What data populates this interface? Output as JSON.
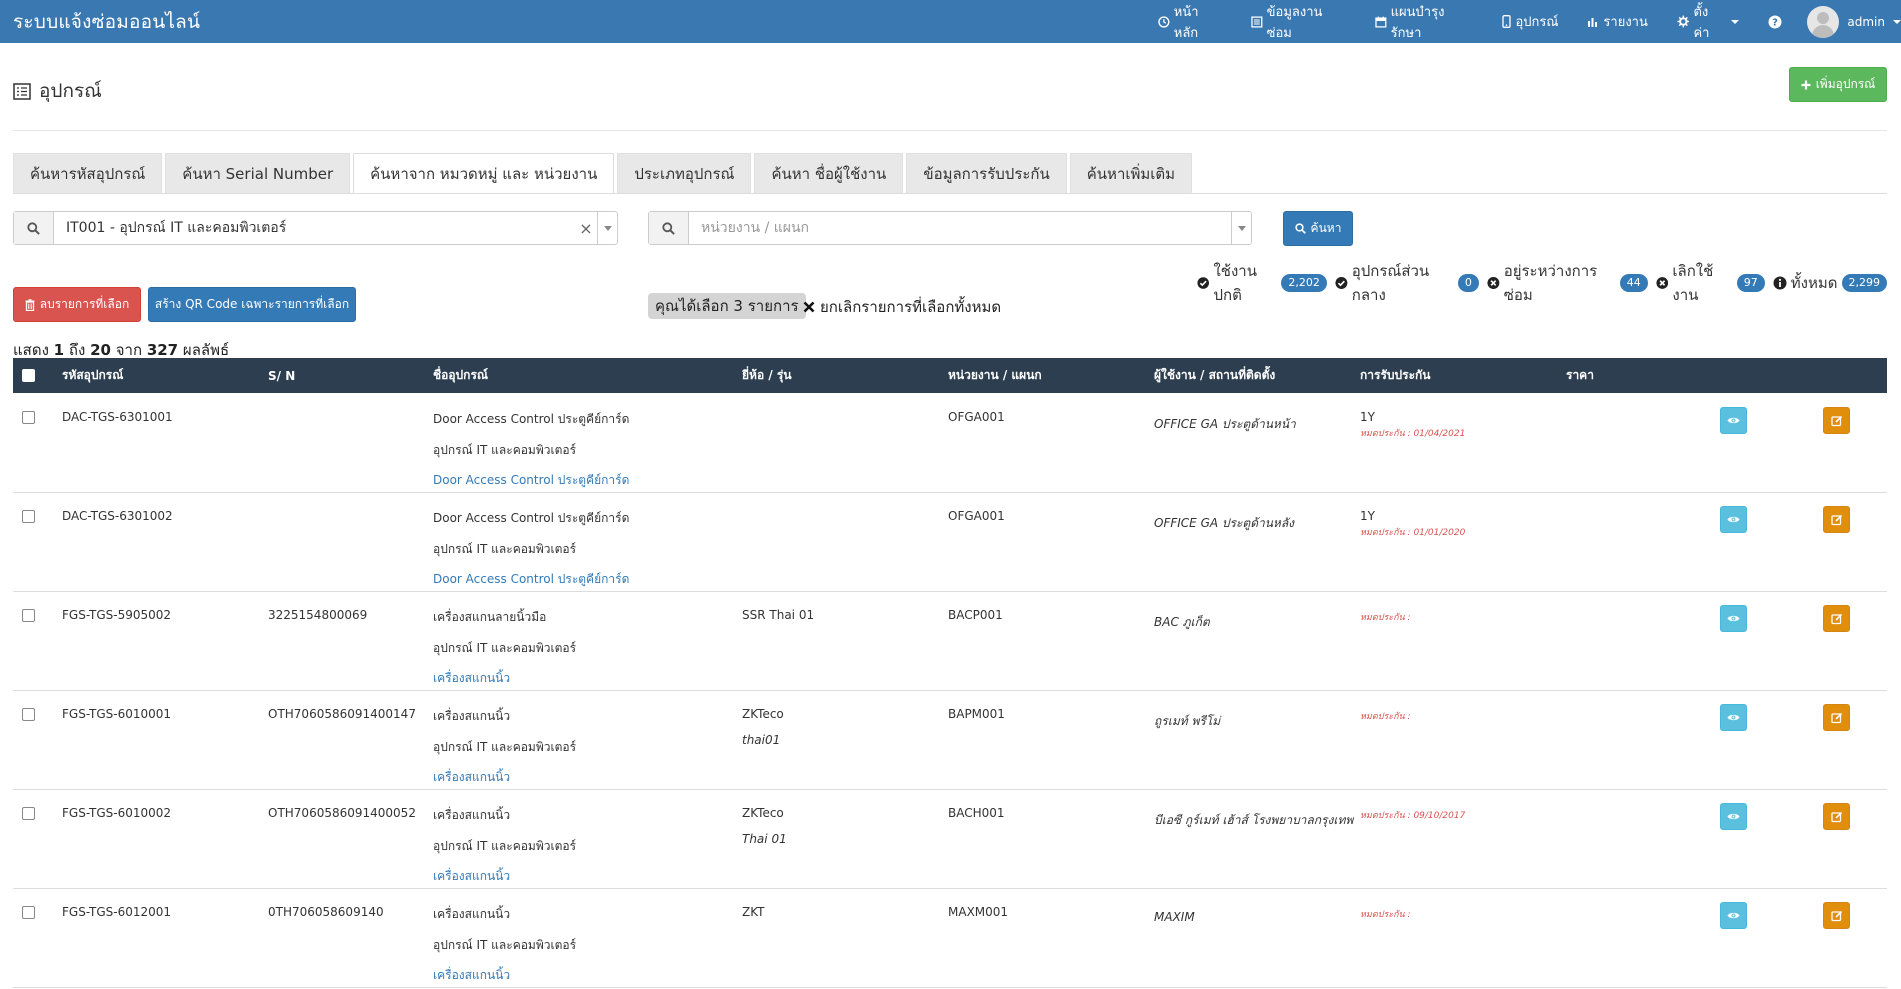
{
  "app": {
    "brand": "ระบบแจ้งซ่อมออนไลน์"
  },
  "nav": {
    "items": [
      {
        "label": "หน้าหลัก",
        "icon": "clock-icon"
      },
      {
        "label": "ข้อมูลงานซ่อม",
        "icon": "list-icon"
      },
      {
        "label": "แผนบำรุงรักษา",
        "icon": "calendar-icon"
      },
      {
        "label": "อุปกรณ์",
        "icon": "mobile-icon"
      },
      {
        "label": "รายงาน",
        "icon": "bar-chart-icon"
      },
      {
        "label": "ตั้งค่า",
        "icon": "gear-icon"
      }
    ],
    "user": "admin"
  },
  "page": {
    "title": "อุปกรณ์",
    "add_button": "เพิ่มอุปกรณ์"
  },
  "tabs": [
    {
      "label": "ค้นหารหัสอุปกรณ์"
    },
    {
      "label": "ค้นหา Serial Number"
    },
    {
      "label": "ค้นหาจาก หมวดหมู่ และ หน่วยงาน"
    },
    {
      "label": "ประเภทอุปกรณ์"
    },
    {
      "label": "ค้นหา ชื่อผู้ใช้งาน"
    },
    {
      "label": "ข้อมูลการรับประกัน"
    },
    {
      "label": "ค้นหาเพิ่มเติม"
    }
  ],
  "search": {
    "category_value": "IT001 - อุปกรณ์ IT และคอมพิวเตอร์",
    "department_placeholder": "หน่วยงาน / แผนก",
    "button": "ค้นหา"
  },
  "status": [
    {
      "label": "ใช้งานปกติ",
      "count": "2,202",
      "icon": "check-circle-icon"
    },
    {
      "label": "อุปกรณ์ส่วนกลาง",
      "count": "0",
      "icon": "check-circle-icon"
    },
    {
      "label": "อยู่ระหว่างการซ่อม",
      "count": "44",
      "icon": "times-circle-icon"
    },
    {
      "label": "เลิกใช้งาน",
      "count": "97",
      "icon": "times-circle-icon"
    },
    {
      "label": "ทั้งหมด",
      "count": "2,299",
      "icon": "info-circle-icon"
    }
  ],
  "actions": {
    "delete_selected": "ลบรายการที่เลือก",
    "qr_selected": "สร้าง QR Code เฉพาะรายการที่เลือก",
    "selected_text": "คุณได้เลือก 3 รายการ",
    "cancel_all": "ยกเลิกรายการที่เลือกทั้งหมด"
  },
  "pagination": {
    "prefix": "แสดง",
    "from": "1",
    "to_word": "ถึง",
    "to": "20",
    "of_word": "จาก",
    "total": "327",
    "suffix": "ผลลัพธ์"
  },
  "table": {
    "columns": [
      "รหัสอุปกรณ์",
      "S/ N",
      "ชื่ออุปกรณ์",
      "ยี่ห้อ / รุ่น",
      "หน่วยงาน / แผนก",
      "ผู้ใช้งาน / สถานที่ติดตั้ง",
      "การรับประกัน",
      "ราคา"
    ],
    "rows": [
      {
        "code": "DAC-TGS-6301001",
        "sn": "",
        "name": "Door Access Control ประตูคีย์การ์ด",
        "category": "อุปกรณ์ IT และคอมพิวเตอร์",
        "type": "Door Access Control ประตูคีย์การ์ด",
        "brand": "",
        "model": "",
        "dept": "OFGA001",
        "user": "OFFICE GA ประตูด้านหน้า",
        "warranty": "1Y",
        "expire": "หมดประกัน : 01/04/2021"
      },
      {
        "code": "DAC-TGS-6301002",
        "sn": "",
        "name": "Door Access Control ประตูคีย์การ์ด",
        "category": "อุปกรณ์ IT และคอมพิวเตอร์",
        "type": "Door Access Control ประตูคีย์การ์ด",
        "brand": "",
        "model": "",
        "dept": "OFGA001",
        "user": "OFFICE GA ประตูด้านหลัง",
        "warranty": "1Y",
        "expire": "หมดประกัน : 01/01/2020"
      },
      {
        "code": "FGS-TGS-5905002",
        "sn": "3225154800069",
        "name": "เครื่องสแกนลายนิ้วมือ",
        "category": "อุปกรณ์ IT และคอมพิวเตอร์",
        "type": "เครื่องสแกนนิ้ว",
        "brand": "SSR Thai 01",
        "model": "",
        "dept": "BACP001",
        "user": "BAC ภูเก็ต",
        "warranty": "",
        "expire": "หมดประกัน :"
      },
      {
        "code": "FGS-TGS-6010001",
        "sn": "OTH7060586091400147",
        "name": "เครื่องสแกนนิ้ว",
        "category": "อุปกรณ์ IT และคอมพิวเตอร์",
        "type": "เครื่องสแกนนิ้ว",
        "brand": "ZKTeco",
        "model": "thai01",
        "dept": "BAPM001",
        "user": "ถูรเมท์ พรีโม่",
        "warranty": "",
        "expire": "หมดประกัน :"
      },
      {
        "code": "FGS-TGS-6010002",
        "sn": "OTH7060586091400052",
        "name": "เครื่องสแกนนิ้ว",
        "category": "อุปกรณ์ IT และคอมพิวเตอร์",
        "type": "เครื่องสแกนนิ้ว",
        "brand": "ZKTeco",
        "model": "Thai 01",
        "dept": "BACH001",
        "user": "บีเอซี กูร์เมท์ เฮ้าส์ โรงพยาบาลกรุงเทพ",
        "warranty": "",
        "expire": "หมดประกัน : 09/10/2017"
      },
      {
        "code": "FGS-TGS-6012001",
        "sn": "0TH706058609140",
        "name": "เครื่องสแกนนิ้ว",
        "category": "อุปกรณ์ IT และคอมพิวเตอร์",
        "type": "เครื่องสแกนนิ้ว",
        "brand": "ZKT",
        "model": "",
        "dept": "MAXM001",
        "user": "MAXIM",
        "warranty": "",
        "expire": "หมดประกัน :"
      }
    ]
  },
  "colors": {
    "navbar": "#3a78b1",
    "table_header": "#2c3e50",
    "success": "#5cb85c",
    "danger": "#d9534f",
    "primary": "#337ab7",
    "info": "#5bc0de",
    "warning": "#e08e0b"
  }
}
